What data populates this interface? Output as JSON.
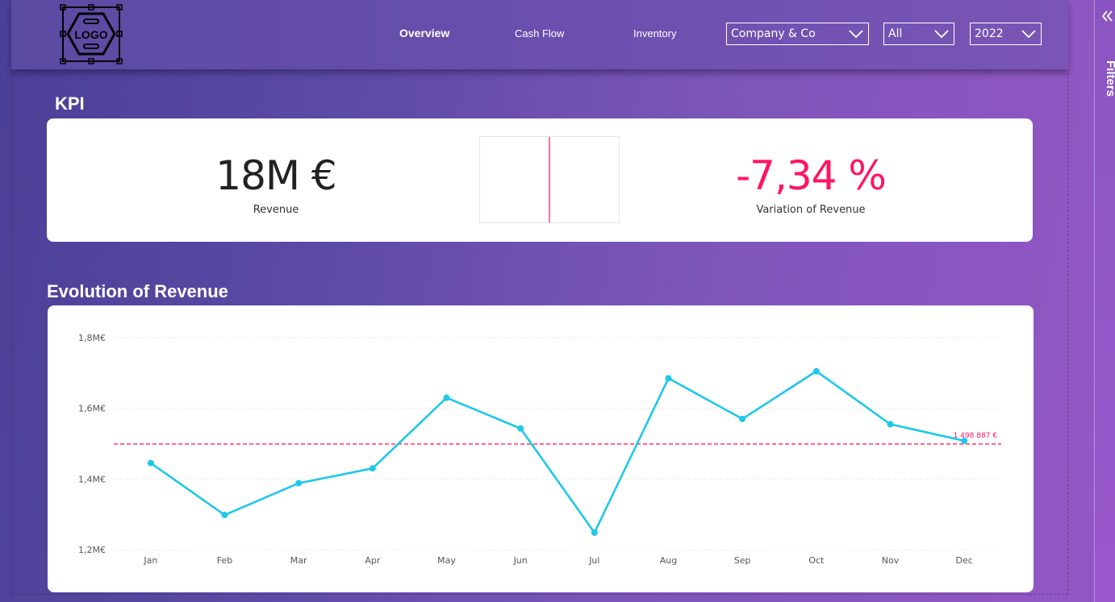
{
  "header": {
    "logo_text": "LOGO",
    "nav": [
      {
        "label": "Overview",
        "active": true
      },
      {
        "label": "Cash Flow",
        "active": false
      },
      {
        "label": "Inventory",
        "active": false
      }
    ],
    "filters": {
      "company": "Company & Co",
      "segment": "All",
      "year": "2022"
    }
  },
  "filters_pane": {
    "label": "Filters",
    "collapse_icon": "double-chevron-left-icon"
  },
  "kpi": {
    "title": "KPI",
    "revenue_value": "18M €",
    "revenue_label": "Revenue",
    "variation_value": "-7,34 %",
    "variation_label": "Variation of Revenue"
  },
  "colors": {
    "accent_line": "#1ec8e8",
    "average_line": "#ff6f9a",
    "negative": "#ff1463",
    "value_text": "#222222"
  },
  "chart_section": {
    "title": "Evolution of Revenue"
  },
  "chart_data": {
    "type": "line",
    "title": "",
    "xlabel": "",
    "ylabel": "",
    "categories": [
      "Jan",
      "Feb",
      "Mar",
      "Apr",
      "May",
      "Jun",
      "Jul",
      "Aug",
      "Sep",
      "Oct",
      "Nov",
      "Dec"
    ],
    "series": [
      {
        "values": [
          1.445,
          1.298,
          1.388,
          1.43,
          1.63,
          1.543,
          1.248,
          1.685,
          1.57,
          1.705,
          1.555,
          1.508
        ]
      }
    ],
    "reference_line": {
      "value": 1.498887,
      "label": "1 498 887 €"
    },
    "ylim": [
      1.2,
      1.8
    ],
    "yticks": [
      1.2,
      1.4,
      1.6,
      1.8
    ],
    "ytick_labels": [
      "1,2M€",
      "1,4M€",
      "1,6M€",
      "1,8M€"
    ],
    "grid": true
  }
}
